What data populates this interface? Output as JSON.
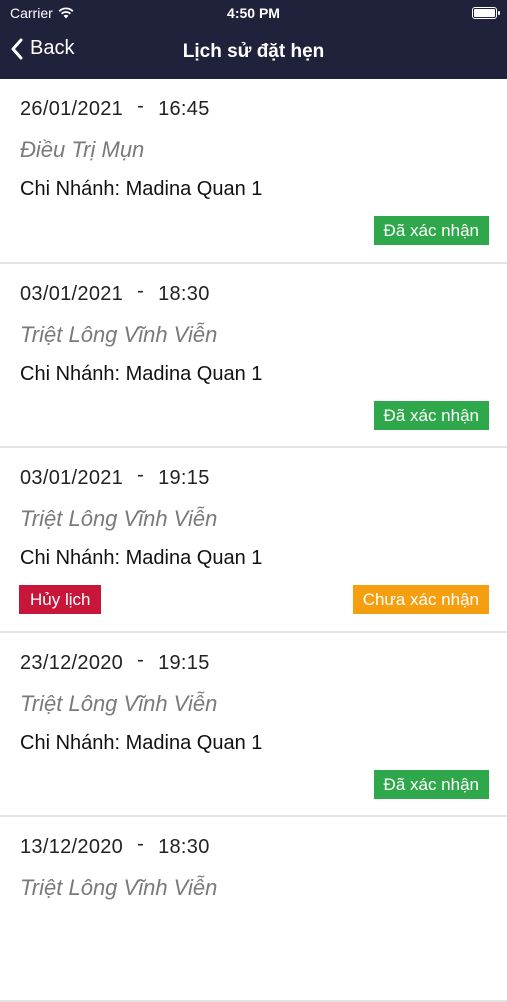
{
  "status_bar": {
    "carrier": "Carrier",
    "time": "4:50 PM"
  },
  "nav": {
    "back_label": "Back",
    "title": "Lịch sử đặt hẹn"
  },
  "appointments": [
    {
      "date": "26/01/2021",
      "sep": "-",
      "time": "16:45",
      "service": "Điều Trị Mụn",
      "branch": "Chi Nhánh: Madina Quan 1",
      "status": "Đã xác nhận",
      "cancel": ""
    },
    {
      "date": "03/01/2021",
      "sep": "-",
      "time": "18:30",
      "service": "Triệt Lông Vĩnh Viễn",
      "branch": "Chi Nhánh: Madina Quan 1",
      "status": "Đã xác nhận",
      "cancel": ""
    },
    {
      "date": "03/01/2021",
      "sep": "-",
      "time": "19:15",
      "service": "Triệt Lông Vĩnh Viễn",
      "branch": "Chi Nhánh: Madina Quan 1",
      "status": "Chưa xác nhận",
      "cancel": "Hủy lịch"
    },
    {
      "date": "23/12/2020",
      "sep": "-",
      "time": "19:15",
      "service": "Triệt Lông Vĩnh Viễn",
      "branch": "Chi Nhánh: Madina Quan 1",
      "status": "Đã xác nhận",
      "cancel": ""
    },
    {
      "date": "13/12/2020",
      "sep": "-",
      "time": "18:30",
      "service": "Triệt Lông Vĩnh Viễn",
      "branch": "",
      "status": "",
      "cancel": ""
    }
  ],
  "colors": {
    "header_bg": "#20213a",
    "confirmed": "#2ea84a",
    "pending": "#f59f10",
    "cancel": "#c8163a"
  },
  "icons": {
    "back": "chevron-left-icon",
    "wifi": "wifi-icon",
    "battery": "battery-icon"
  }
}
